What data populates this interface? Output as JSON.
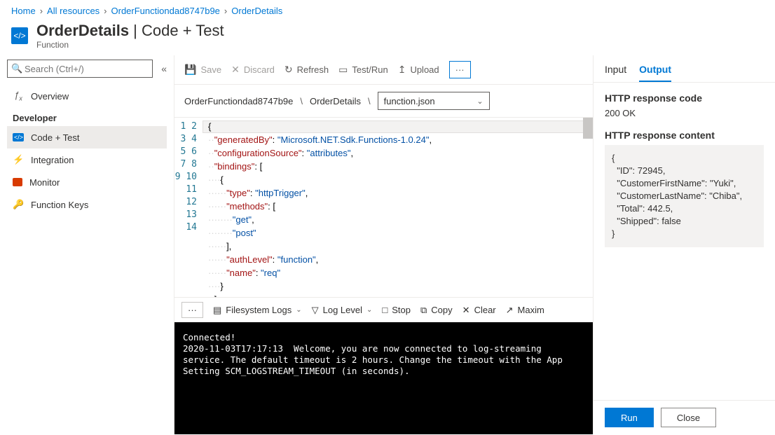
{
  "breadcrumb": [
    "Home",
    "All resources",
    "OrderFunctiondad8747b9e",
    "OrderDetails"
  ],
  "header": {
    "title_bold": "OrderDetails",
    "title_rest": " | Code + Test",
    "subtitle": "Function"
  },
  "sidebar": {
    "search_placeholder": "Search (Ctrl+/)",
    "overview": "Overview",
    "section": "Developer",
    "items": [
      {
        "label": "Code + Test",
        "icon_color": "#0078d4"
      },
      {
        "label": "Integration",
        "icon_color": "#ffb900"
      },
      {
        "label": "Monitor",
        "icon_color": "#d83b01"
      },
      {
        "label": "Function Keys",
        "icon_color": "#ffb900"
      }
    ]
  },
  "toolbar": {
    "save": "Save",
    "discard": "Discard",
    "refresh": "Refresh",
    "testrun": "Test/Run",
    "upload": "Upload"
  },
  "path": {
    "seg1": "OrderFunctiondad8747b9e",
    "seg2": "OrderDetails",
    "file": "function.json"
  },
  "code": {
    "lines": [
      "{",
      "  \"generatedBy\": \"Microsoft.NET.Sdk.Functions-1.0.24\",",
      "  \"configurationSource\": \"attributes\",",
      "  \"bindings\": [",
      "    {",
      "      \"type\": \"httpTrigger\",",
      "      \"methods\": [",
      "        \"get\",",
      "        \"post\"",
      "      ],",
      "      \"authLevel\": \"function\",",
      "      \"name\": \"req\"",
      "    }",
      "  ],"
    ]
  },
  "logbar": {
    "fs": "Filesystem Logs",
    "level": "Log Level",
    "stop": "Stop",
    "copy": "Copy",
    "clear": "Clear",
    "max": "Maxim"
  },
  "console": "Connected!\n2020-11-03T17:17:13  Welcome, you are now connected to log-streaming service. The default timeout is 2 hours. Change the timeout with the App Setting SCM_LOGSTREAM_TIMEOUT (in seconds).",
  "right": {
    "tab_input": "Input",
    "tab_output": "Output",
    "code_label": "HTTP response code",
    "code_value": "200 OK",
    "content_label": "HTTP response content",
    "content_value": "{\n  \"ID\": 72945,\n  \"CustomerFirstName\": \"Yuki\",\n  \"CustomerLastName\": \"Chiba\",\n  \"Total\": 442.5,\n  \"Shipped\": false\n}",
    "run": "Run",
    "close": "Close"
  }
}
